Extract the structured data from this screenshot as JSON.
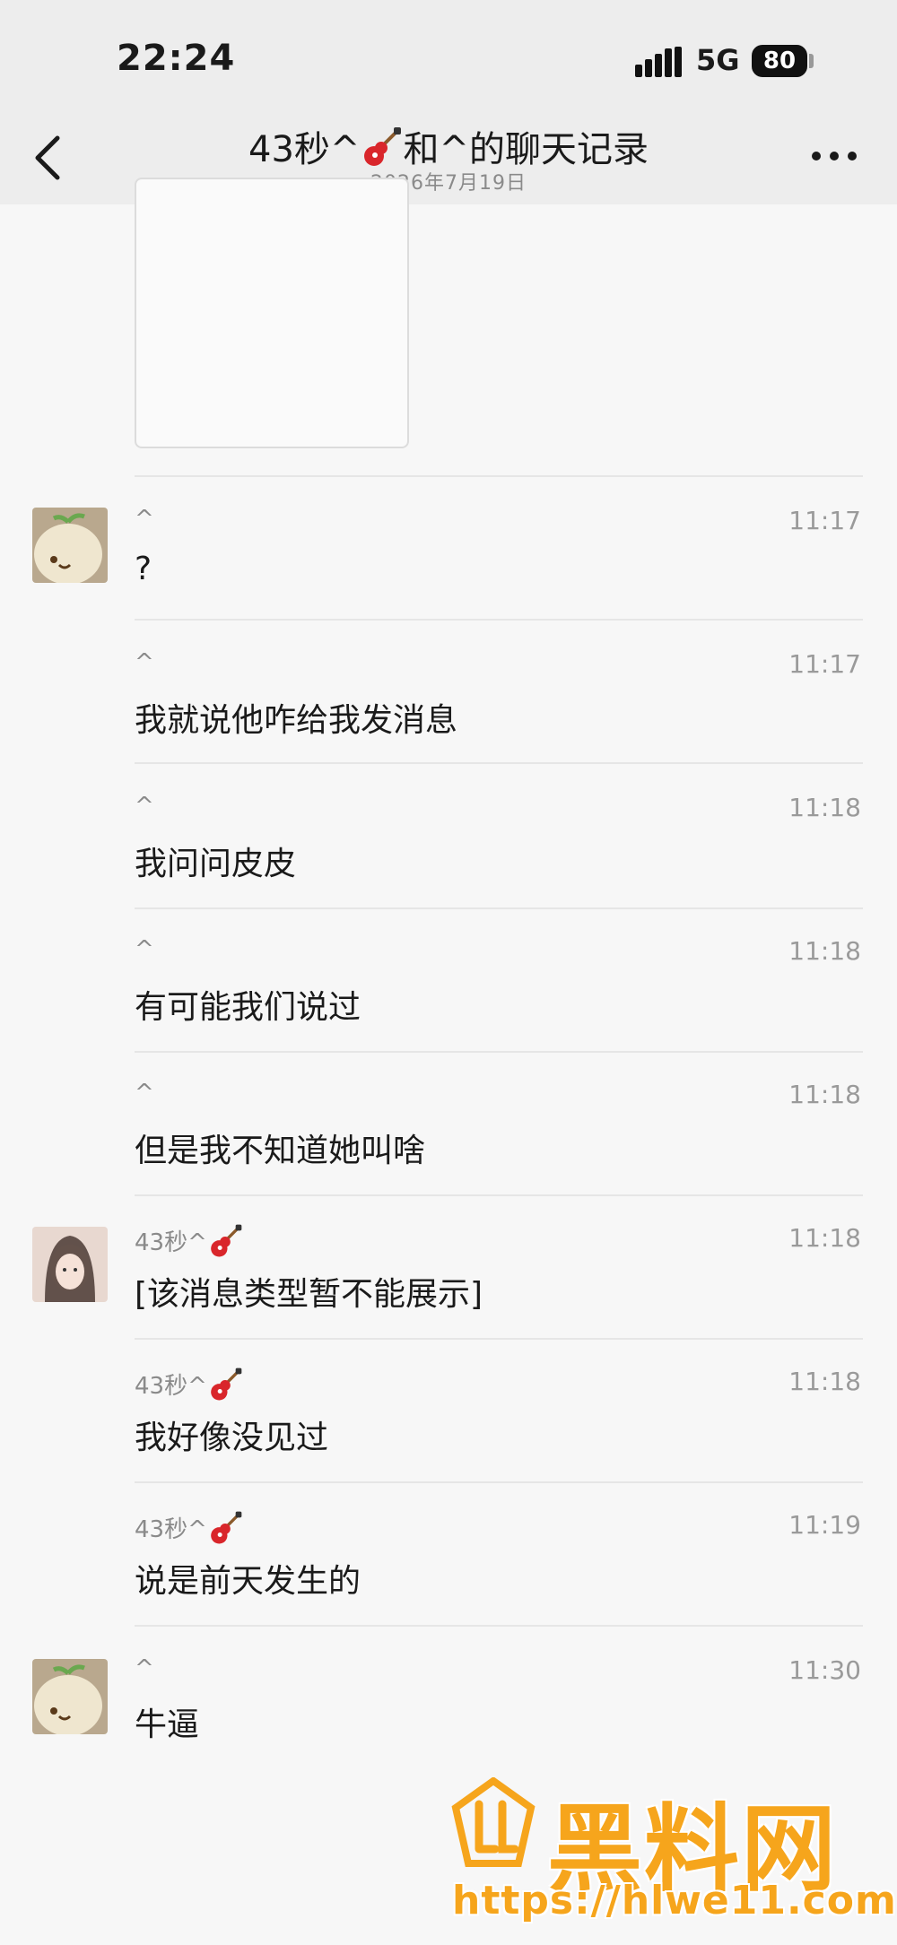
{
  "status_bar": {
    "time": "22:24",
    "network": "5G",
    "battery": "80"
  },
  "nav": {
    "title_before": "43秒^",
    "title_after": "和^的聊天记录",
    "subtitle": "2026年7月19日"
  },
  "messages": [
    {
      "sender": "^",
      "time": "11:17",
      "text": "?"
    },
    {
      "sender": "^",
      "time": "11:17",
      "text": "我就说他咋给我发消息"
    },
    {
      "sender": "^",
      "time": "11:18",
      "text": "我问问皮皮"
    },
    {
      "sender": "^",
      "time": "11:18",
      "text": "有可能我们说过"
    },
    {
      "sender": "^",
      "time": "11:18",
      "text": "但是我不知道她叫啥"
    },
    {
      "sender": "43秒^",
      "time": "11:18",
      "text": "[该消息类型暂不能展示]"
    },
    {
      "sender": "43秒^",
      "time": "11:18",
      "text": "我好像没见过"
    },
    {
      "sender": "43秒^",
      "time": "11:19",
      "text": "说是前天发生的"
    },
    {
      "sender": "^",
      "time": "11:30",
      "text": "牛逼"
    }
  ],
  "watermark": {
    "title": "黑料网",
    "url": "https://hlwe11.com"
  },
  "colors": {
    "header_bg": "#ededed",
    "page_bg": "#f7f7f7",
    "watermark": "#f6a51c"
  },
  "icons": [
    "back-arrow-icon",
    "more-dots-icon",
    "signal-icon",
    "battery-icon",
    "guitar-emoji-icon"
  ]
}
